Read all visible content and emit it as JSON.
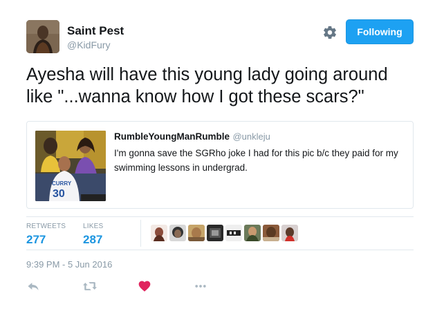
{
  "author": {
    "display_name": "Saint Pest",
    "handle": "@KidFury"
  },
  "header": {
    "follow_label": "Following",
    "settings_icon": "gear-icon",
    "accent": "#1da1f2"
  },
  "tweet": {
    "text": "Ayesha will have this young lady going around like \"...wanna know how I got these scars?\""
  },
  "quoted_tweet": {
    "name": "RumbleYoungManRumble",
    "handle": "@unkleju",
    "text": "I'm gonna save the SGRho joke I had for this pic b/c they paid for my swimming lessons in undergrad."
  },
  "stats": {
    "retweets_label": "RETWEETS",
    "retweets_count": "277",
    "likes_label": "LIKES",
    "likes_count": "287"
  },
  "timestamp": "9:39 PM - 5 Jun 2016",
  "actions": {
    "reply_icon": "reply-icon",
    "retweet_icon": "retweet-icon",
    "like_icon": "heart-icon",
    "more_icon": "more-icon",
    "like_color": "#e0245e",
    "icon_color": "#aab8c2"
  }
}
